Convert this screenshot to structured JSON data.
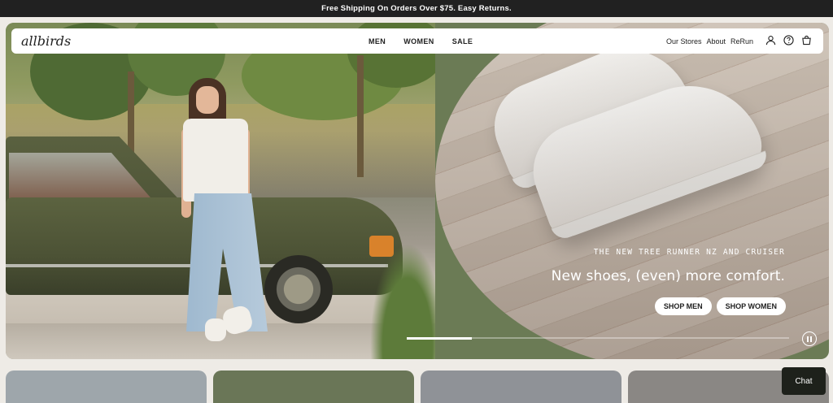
{
  "announcement": "Free Shipping On Orders Over $75. Easy Returns.",
  "header": {
    "logo": "allbirds",
    "nav_center": [
      "MEN",
      "WOMEN",
      "SALE"
    ],
    "nav_right": [
      "Our Stores",
      "About",
      "ReRun"
    ],
    "icons": [
      "user-icon",
      "help-icon",
      "cart-icon"
    ]
  },
  "hero": {
    "eyebrow": "THE NEW TREE RUNNER NZ AND CRUISER",
    "headline": "New shoes, (even) more comfort.",
    "cta_men": "SHOP MEN",
    "cta_women": "SHOP WOMEN",
    "slide_progress": 0.17,
    "pause_icon": "pause-icon"
  },
  "bottom_cards": {
    "colors": [
      "#9ea6ab",
      "#6a7657",
      "#8f9297",
      "#8a8784"
    ]
  },
  "chat_label": "Chat",
  "colors": {
    "topbar": "#212121",
    "hero_green": "#6b7b55",
    "page_bg": "#eeebe6"
  }
}
